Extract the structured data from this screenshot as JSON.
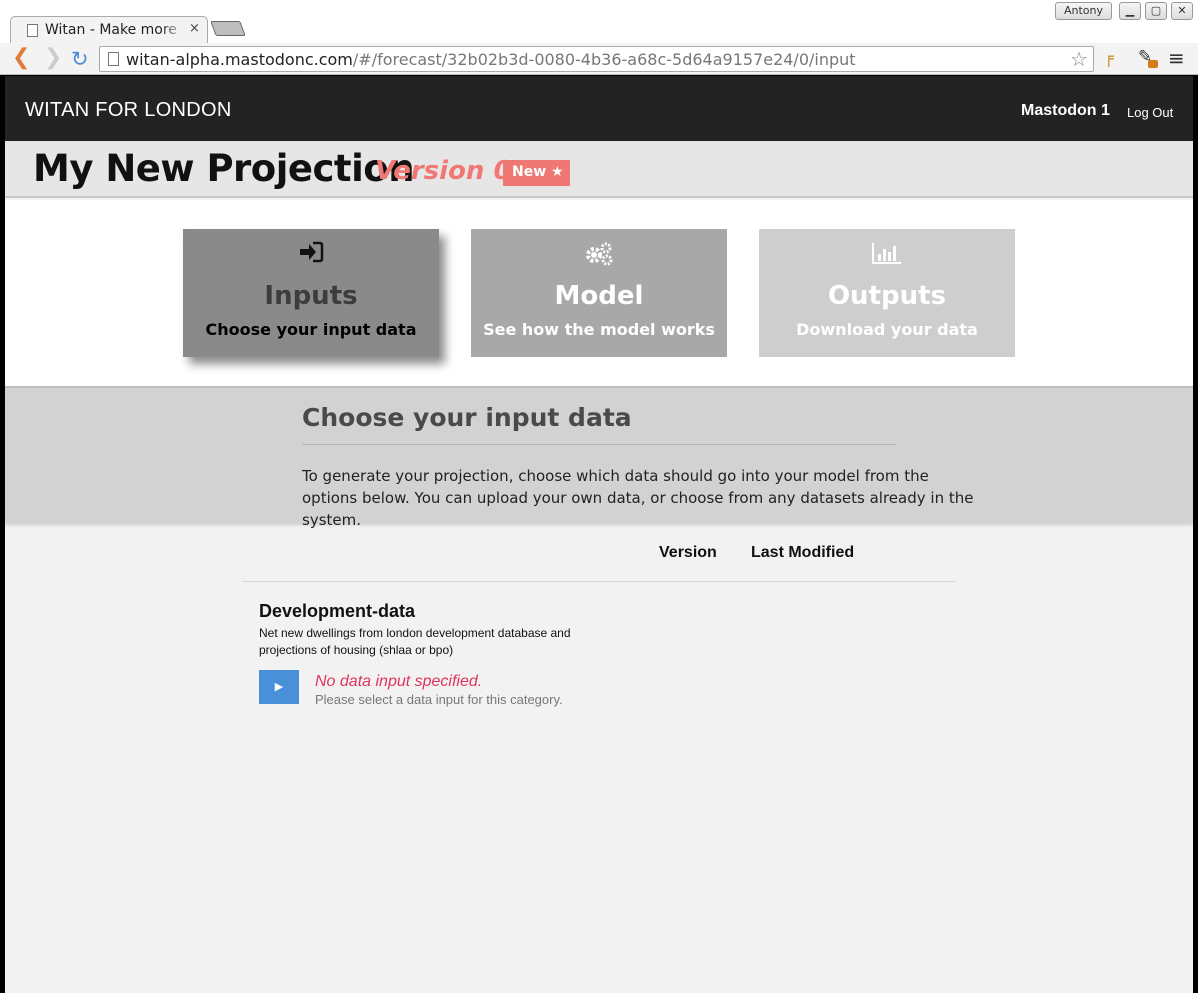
{
  "browser": {
    "window_user": "Antony",
    "tab_title": "Witan - Make more s",
    "tab_close": "×",
    "url_host": "witan-alpha.mastodonc.com",
    "url_path": "/#/forecast/32b02b3d-0080-4b36-a68c-5d64a9157e24/0/input",
    "icons": [
      "back-icon",
      "forward-icon",
      "reload-icon",
      "star-icon",
      "menu-icon"
    ]
  },
  "nav": {
    "brand": "WITAN FOR LONDON",
    "user": "Mastodon 1",
    "logout": "Log Out"
  },
  "projection": {
    "title": "My New Projection",
    "version": "Version 0",
    "badge": "New"
  },
  "steps": [
    {
      "title": "Inputs",
      "subtitle": "Choose your input data",
      "icon": "sign-in-icon",
      "state": "active"
    },
    {
      "title": "Model",
      "subtitle": "See how the model works",
      "icon": "gears-icon",
      "state": "inactive"
    },
    {
      "title": "Outputs",
      "subtitle": "Download your data",
      "icon": "bar-chart-icon",
      "state": "disabled"
    }
  ],
  "choose": {
    "title": "Choose your input data",
    "description": "To generate your projection, choose which data should go into your model from the options below. You can upload your own data, or choose from any datasets already in the system."
  },
  "table": {
    "columns": [
      "Version",
      "Last Modified"
    ],
    "rows": [
      {
        "name": "Development-data",
        "description": "Net new dwellings from london development database and projections of housing (shlaa or bpo)",
        "status": "No data input specified.",
        "help": "Please select a data input for this category."
      }
    ]
  },
  "colors": {
    "nav_bg": "#232323",
    "accent": "#f07874",
    "play_button": "#4a90d9",
    "error": "#e0335d"
  }
}
